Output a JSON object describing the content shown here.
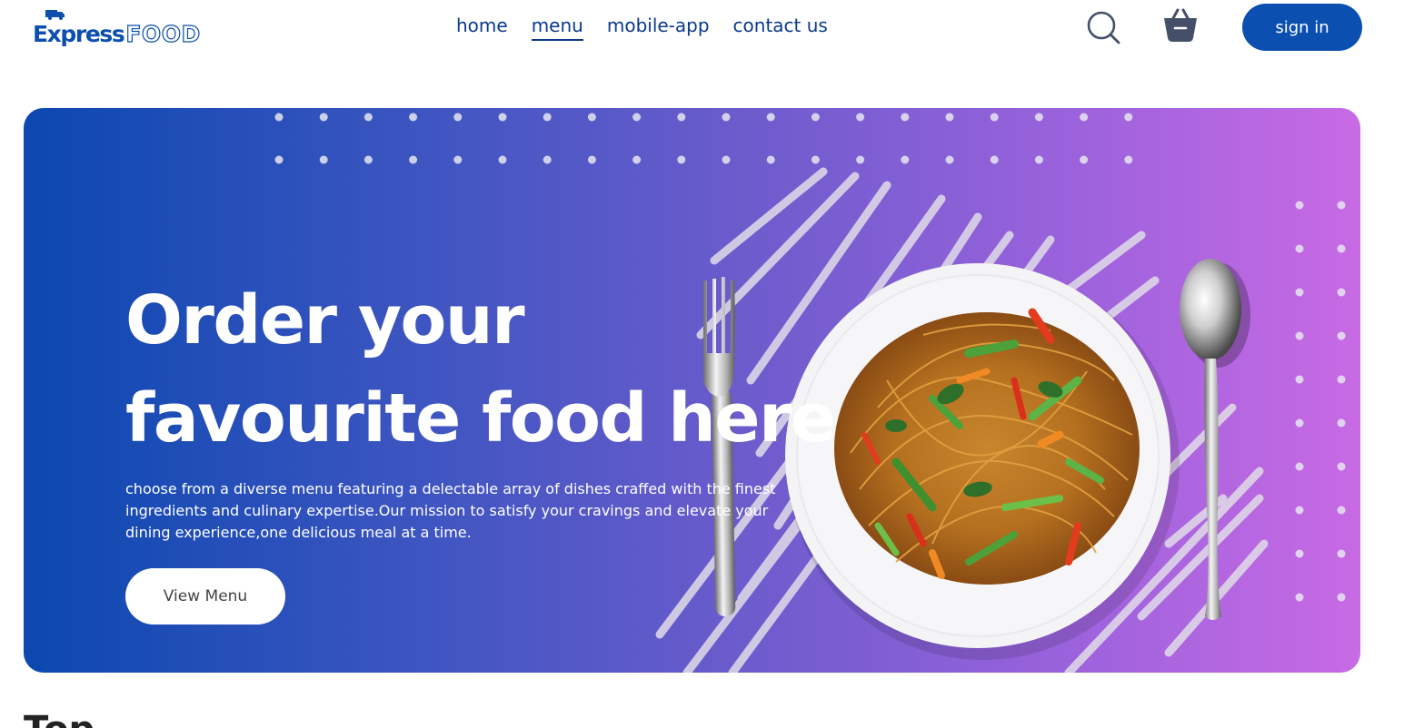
{
  "brand": {
    "name_part1": "Express",
    "name_part2": "FOOD"
  },
  "nav": {
    "items": [
      {
        "label": "home"
      },
      {
        "label": "menu",
        "active": true
      },
      {
        "label": "mobile-app"
      },
      {
        "label": "contact us"
      }
    ]
  },
  "header": {
    "search_icon": "search-icon",
    "cart_icon": "basket-icon",
    "signin_label": "sign in"
  },
  "hero": {
    "title_line1": "Order your",
    "title_line2": "favourite food here",
    "description": "choose from a diverse menu featuring a delectable array of dishes craffed with the finest ingredients and culinary expertise.Our mission to satisfy your cravings and elevate your dining experience,one delicious meal at a time.",
    "cta_label": "View Menu"
  },
  "next_section": {
    "heading_partial": "Top"
  },
  "colors": {
    "brand_blue": "#0b4fb0",
    "nav_text": "#0b3a8a",
    "gradient_start": "#0b48b0",
    "gradient_end": "#c86ae4"
  }
}
